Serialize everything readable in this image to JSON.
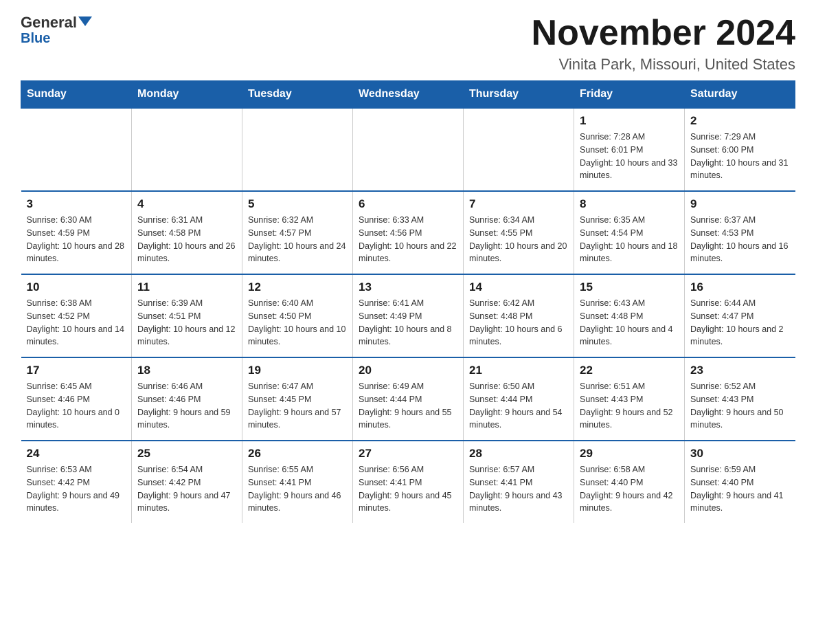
{
  "header": {
    "logo_general": "General",
    "logo_blue": "Blue",
    "month_title": "November 2024",
    "location": "Vinita Park, Missouri, United States"
  },
  "weekdays": [
    "Sunday",
    "Monday",
    "Tuesday",
    "Wednesday",
    "Thursday",
    "Friday",
    "Saturday"
  ],
  "weeks": [
    [
      {
        "day": "",
        "sunrise": "",
        "sunset": "",
        "daylight": ""
      },
      {
        "day": "",
        "sunrise": "",
        "sunset": "",
        "daylight": ""
      },
      {
        "day": "",
        "sunrise": "",
        "sunset": "",
        "daylight": ""
      },
      {
        "day": "",
        "sunrise": "",
        "sunset": "",
        "daylight": ""
      },
      {
        "day": "",
        "sunrise": "",
        "sunset": "",
        "daylight": ""
      },
      {
        "day": "1",
        "sunrise": "Sunrise: 7:28 AM",
        "sunset": "Sunset: 6:01 PM",
        "daylight": "Daylight: 10 hours and 33 minutes."
      },
      {
        "day": "2",
        "sunrise": "Sunrise: 7:29 AM",
        "sunset": "Sunset: 6:00 PM",
        "daylight": "Daylight: 10 hours and 31 minutes."
      }
    ],
    [
      {
        "day": "3",
        "sunrise": "Sunrise: 6:30 AM",
        "sunset": "Sunset: 4:59 PM",
        "daylight": "Daylight: 10 hours and 28 minutes."
      },
      {
        "day": "4",
        "sunrise": "Sunrise: 6:31 AM",
        "sunset": "Sunset: 4:58 PM",
        "daylight": "Daylight: 10 hours and 26 minutes."
      },
      {
        "day": "5",
        "sunrise": "Sunrise: 6:32 AM",
        "sunset": "Sunset: 4:57 PM",
        "daylight": "Daylight: 10 hours and 24 minutes."
      },
      {
        "day": "6",
        "sunrise": "Sunrise: 6:33 AM",
        "sunset": "Sunset: 4:56 PM",
        "daylight": "Daylight: 10 hours and 22 minutes."
      },
      {
        "day": "7",
        "sunrise": "Sunrise: 6:34 AM",
        "sunset": "Sunset: 4:55 PM",
        "daylight": "Daylight: 10 hours and 20 minutes."
      },
      {
        "day": "8",
        "sunrise": "Sunrise: 6:35 AM",
        "sunset": "Sunset: 4:54 PM",
        "daylight": "Daylight: 10 hours and 18 minutes."
      },
      {
        "day": "9",
        "sunrise": "Sunrise: 6:37 AM",
        "sunset": "Sunset: 4:53 PM",
        "daylight": "Daylight: 10 hours and 16 minutes."
      }
    ],
    [
      {
        "day": "10",
        "sunrise": "Sunrise: 6:38 AM",
        "sunset": "Sunset: 4:52 PM",
        "daylight": "Daylight: 10 hours and 14 minutes."
      },
      {
        "day": "11",
        "sunrise": "Sunrise: 6:39 AM",
        "sunset": "Sunset: 4:51 PM",
        "daylight": "Daylight: 10 hours and 12 minutes."
      },
      {
        "day": "12",
        "sunrise": "Sunrise: 6:40 AM",
        "sunset": "Sunset: 4:50 PM",
        "daylight": "Daylight: 10 hours and 10 minutes."
      },
      {
        "day": "13",
        "sunrise": "Sunrise: 6:41 AM",
        "sunset": "Sunset: 4:49 PM",
        "daylight": "Daylight: 10 hours and 8 minutes."
      },
      {
        "day": "14",
        "sunrise": "Sunrise: 6:42 AM",
        "sunset": "Sunset: 4:48 PM",
        "daylight": "Daylight: 10 hours and 6 minutes."
      },
      {
        "day": "15",
        "sunrise": "Sunrise: 6:43 AM",
        "sunset": "Sunset: 4:48 PM",
        "daylight": "Daylight: 10 hours and 4 minutes."
      },
      {
        "day": "16",
        "sunrise": "Sunrise: 6:44 AM",
        "sunset": "Sunset: 4:47 PM",
        "daylight": "Daylight: 10 hours and 2 minutes."
      }
    ],
    [
      {
        "day": "17",
        "sunrise": "Sunrise: 6:45 AM",
        "sunset": "Sunset: 4:46 PM",
        "daylight": "Daylight: 10 hours and 0 minutes."
      },
      {
        "day": "18",
        "sunrise": "Sunrise: 6:46 AM",
        "sunset": "Sunset: 4:46 PM",
        "daylight": "Daylight: 9 hours and 59 minutes."
      },
      {
        "day": "19",
        "sunrise": "Sunrise: 6:47 AM",
        "sunset": "Sunset: 4:45 PM",
        "daylight": "Daylight: 9 hours and 57 minutes."
      },
      {
        "day": "20",
        "sunrise": "Sunrise: 6:49 AM",
        "sunset": "Sunset: 4:44 PM",
        "daylight": "Daylight: 9 hours and 55 minutes."
      },
      {
        "day": "21",
        "sunrise": "Sunrise: 6:50 AM",
        "sunset": "Sunset: 4:44 PM",
        "daylight": "Daylight: 9 hours and 54 minutes."
      },
      {
        "day": "22",
        "sunrise": "Sunrise: 6:51 AM",
        "sunset": "Sunset: 4:43 PM",
        "daylight": "Daylight: 9 hours and 52 minutes."
      },
      {
        "day": "23",
        "sunrise": "Sunrise: 6:52 AM",
        "sunset": "Sunset: 4:43 PM",
        "daylight": "Daylight: 9 hours and 50 minutes."
      }
    ],
    [
      {
        "day": "24",
        "sunrise": "Sunrise: 6:53 AM",
        "sunset": "Sunset: 4:42 PM",
        "daylight": "Daylight: 9 hours and 49 minutes."
      },
      {
        "day": "25",
        "sunrise": "Sunrise: 6:54 AM",
        "sunset": "Sunset: 4:42 PM",
        "daylight": "Daylight: 9 hours and 47 minutes."
      },
      {
        "day": "26",
        "sunrise": "Sunrise: 6:55 AM",
        "sunset": "Sunset: 4:41 PM",
        "daylight": "Daylight: 9 hours and 46 minutes."
      },
      {
        "day": "27",
        "sunrise": "Sunrise: 6:56 AM",
        "sunset": "Sunset: 4:41 PM",
        "daylight": "Daylight: 9 hours and 45 minutes."
      },
      {
        "day": "28",
        "sunrise": "Sunrise: 6:57 AM",
        "sunset": "Sunset: 4:41 PM",
        "daylight": "Daylight: 9 hours and 43 minutes."
      },
      {
        "day": "29",
        "sunrise": "Sunrise: 6:58 AM",
        "sunset": "Sunset: 4:40 PM",
        "daylight": "Daylight: 9 hours and 42 minutes."
      },
      {
        "day": "30",
        "sunrise": "Sunrise: 6:59 AM",
        "sunset": "Sunset: 4:40 PM",
        "daylight": "Daylight: 9 hours and 41 minutes."
      }
    ]
  ]
}
